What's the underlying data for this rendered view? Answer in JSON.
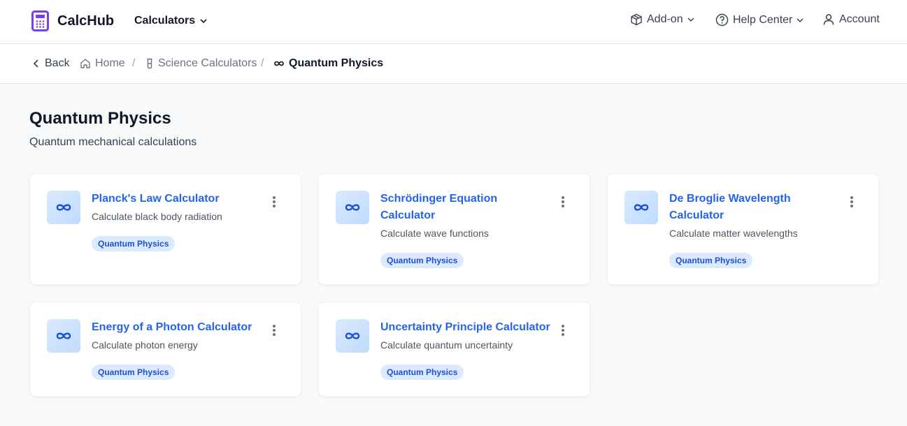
{
  "header": {
    "logo_text": "CalcHub",
    "calculators_label": "Calculators",
    "addon_label": "Add-on",
    "help_label": "Help Center",
    "account_label": "Account"
  },
  "breadcrumb": {
    "back": "Back",
    "home": "Home",
    "science": "Science Calculators",
    "current": "Quantum Physics"
  },
  "page": {
    "title": "Quantum Physics",
    "subtitle": "Quantum mechanical calculations"
  },
  "cards": [
    {
      "title": "Planck's Law Calculator",
      "desc": "Calculate black body radiation",
      "tag": "Quantum Physics",
      "icon": "infinity-icon"
    },
    {
      "title": "Schrödinger Equation Calculator",
      "desc": "Calculate wave functions",
      "tag": "Quantum Physics",
      "icon": "infinity-icon"
    },
    {
      "title": "De Broglie Wavelength Calculator",
      "desc": "Calculate matter wavelengths",
      "tag": "Quantum Physics",
      "icon": "infinity-icon"
    },
    {
      "title": "Energy of a Photon Calculator",
      "desc": "Calculate photon energy",
      "tag": "Quantum Physics",
      "icon": "infinity-icon"
    },
    {
      "title": "Uncertainty Principle Calculator",
      "desc": "Calculate quantum uncertainty",
      "tag": "Quantum Physics",
      "icon": "infinity-icon"
    }
  ],
  "colors": {
    "accent": "#2563eb",
    "brand": "#7c3aed",
    "tag_bg": "#dbeafe"
  }
}
